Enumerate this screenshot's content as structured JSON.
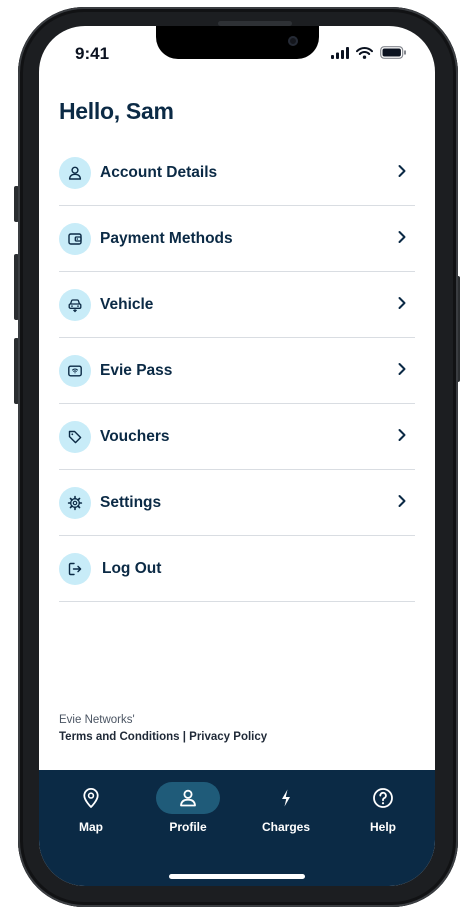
{
  "status_bar": {
    "time": "9:41"
  },
  "header": {
    "greeting": "Hello, Sam"
  },
  "menu": {
    "items": [
      {
        "label": "Account Details",
        "icon": "user-icon",
        "has_chevron": true
      },
      {
        "label": "Payment Methods",
        "icon": "wallet-icon",
        "has_chevron": true
      },
      {
        "label": "Vehicle",
        "icon": "car-icon",
        "has_chevron": true
      },
      {
        "label": "Evie Pass",
        "icon": "card-icon",
        "has_chevron": true
      },
      {
        "label": "Vouchers",
        "icon": "tag-icon",
        "has_chevron": true
      },
      {
        "label": "Settings",
        "icon": "gear-icon",
        "has_chevron": true
      },
      {
        "label": "Log Out",
        "icon": "logout-icon",
        "has_chevron": false
      }
    ]
  },
  "footer": {
    "company": "Evie Networks'",
    "terms": "Terms and Conditions",
    "separator": " | ",
    "privacy": "Privacy Policy"
  },
  "tab_bar": {
    "tabs": [
      {
        "label": "Map",
        "icon": "map-pin-icon",
        "active": false
      },
      {
        "label": "Profile",
        "icon": "user-icon",
        "active": true
      },
      {
        "label": "Charges",
        "icon": "lightning-icon",
        "active": false
      },
      {
        "label": "Help",
        "icon": "help-icon",
        "active": false
      }
    ]
  },
  "colors": {
    "primary": "#0b2a45",
    "icon_bg": "#c8ecf8",
    "active_tab": "#1f5b79",
    "divider": "#d9dde2"
  }
}
